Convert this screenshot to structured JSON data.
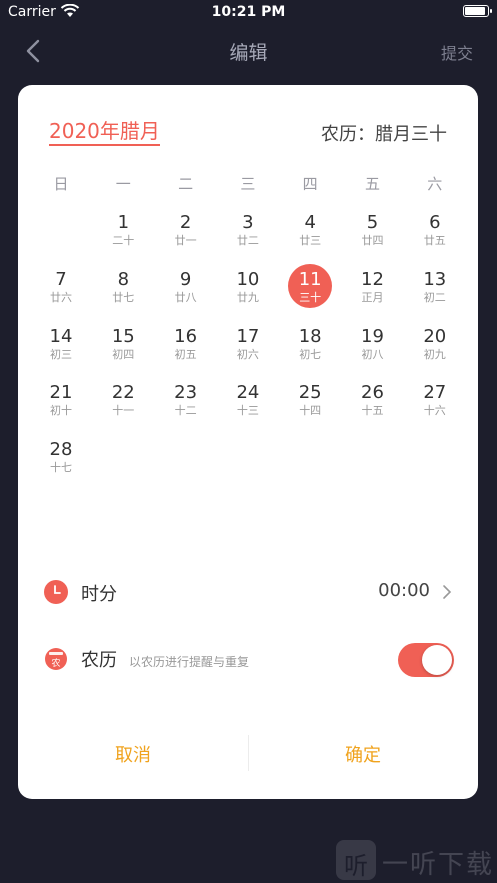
{
  "status": {
    "carrier": "Carrier",
    "time": "10:21 PM",
    "battery_level": 1.0
  },
  "nav": {
    "title": "编辑",
    "submit": "提交"
  },
  "calendar": {
    "month_title": "2020年腊月",
    "lunar_date": "农历：腊月三十",
    "weekdays": [
      "日",
      "一",
      "二",
      "三",
      "四",
      "五",
      "六"
    ],
    "start_column": 1,
    "selected_day": 11,
    "days": [
      {
        "num": "1",
        "lunar": "二十"
      },
      {
        "num": "2",
        "lunar": "廿一"
      },
      {
        "num": "3",
        "lunar": "廿二"
      },
      {
        "num": "4",
        "lunar": "廿三"
      },
      {
        "num": "5",
        "lunar": "廿四"
      },
      {
        "num": "6",
        "lunar": "廿五"
      },
      {
        "num": "7",
        "lunar": "廿六"
      },
      {
        "num": "8",
        "lunar": "廿七"
      },
      {
        "num": "9",
        "lunar": "廿八"
      },
      {
        "num": "10",
        "lunar": "廿九"
      },
      {
        "num": "11",
        "lunar": "三十"
      },
      {
        "num": "12",
        "lunar": "正月"
      },
      {
        "num": "13",
        "lunar": "初二"
      },
      {
        "num": "14",
        "lunar": "初三"
      },
      {
        "num": "15",
        "lunar": "初四"
      },
      {
        "num": "16",
        "lunar": "初五"
      },
      {
        "num": "17",
        "lunar": "初六"
      },
      {
        "num": "18",
        "lunar": "初七"
      },
      {
        "num": "19",
        "lunar": "初八"
      },
      {
        "num": "20",
        "lunar": "初九"
      },
      {
        "num": "21",
        "lunar": "初十"
      },
      {
        "num": "22",
        "lunar": "十一"
      },
      {
        "num": "23",
        "lunar": "十二"
      },
      {
        "num": "24",
        "lunar": "十三"
      },
      {
        "num": "25",
        "lunar": "十四"
      },
      {
        "num": "26",
        "lunar": "十五"
      },
      {
        "num": "27",
        "lunar": "十六"
      },
      {
        "num": "28",
        "lunar": "十七"
      }
    ]
  },
  "time_row": {
    "label": "时分",
    "value": "00:00",
    "icon": "clock-icon"
  },
  "lunar_row": {
    "label": "农历",
    "icon_text": "农",
    "sub": "以农历进行提醒与重复",
    "enabled": true
  },
  "actions": {
    "cancel": "取消",
    "confirm": "确定"
  },
  "watermark": {
    "logo": "听",
    "text": "一听下载"
  },
  "colors": {
    "accent": "#f06055",
    "action": "#f0a31e",
    "background": "#1d1e2c"
  }
}
